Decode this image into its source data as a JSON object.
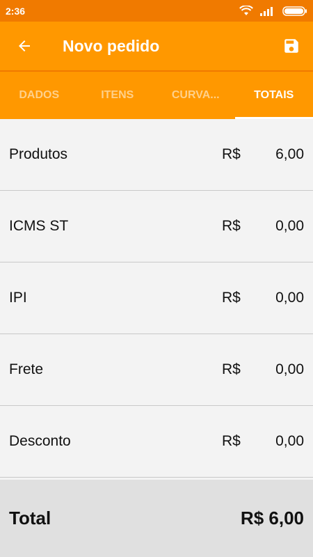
{
  "status": {
    "time": "2:36"
  },
  "toolbar": {
    "title": "Novo pedido"
  },
  "tabs": [
    {
      "label": "DADOS"
    },
    {
      "label": "ITENS"
    },
    {
      "label": "CURVA..."
    },
    {
      "label": "TOTAIS"
    }
  ],
  "totals": {
    "currency": "R$",
    "rows": [
      {
        "label": "Produtos",
        "value": "6,00"
      },
      {
        "label": "ICMS ST",
        "value": "0,00"
      },
      {
        "label": "IPI",
        "value": "0,00"
      },
      {
        "label": "Frete",
        "value": "0,00"
      },
      {
        "label": "Desconto",
        "value": "0,00"
      }
    ],
    "total_label": "Total",
    "total_value": "R$ 6,00"
  }
}
